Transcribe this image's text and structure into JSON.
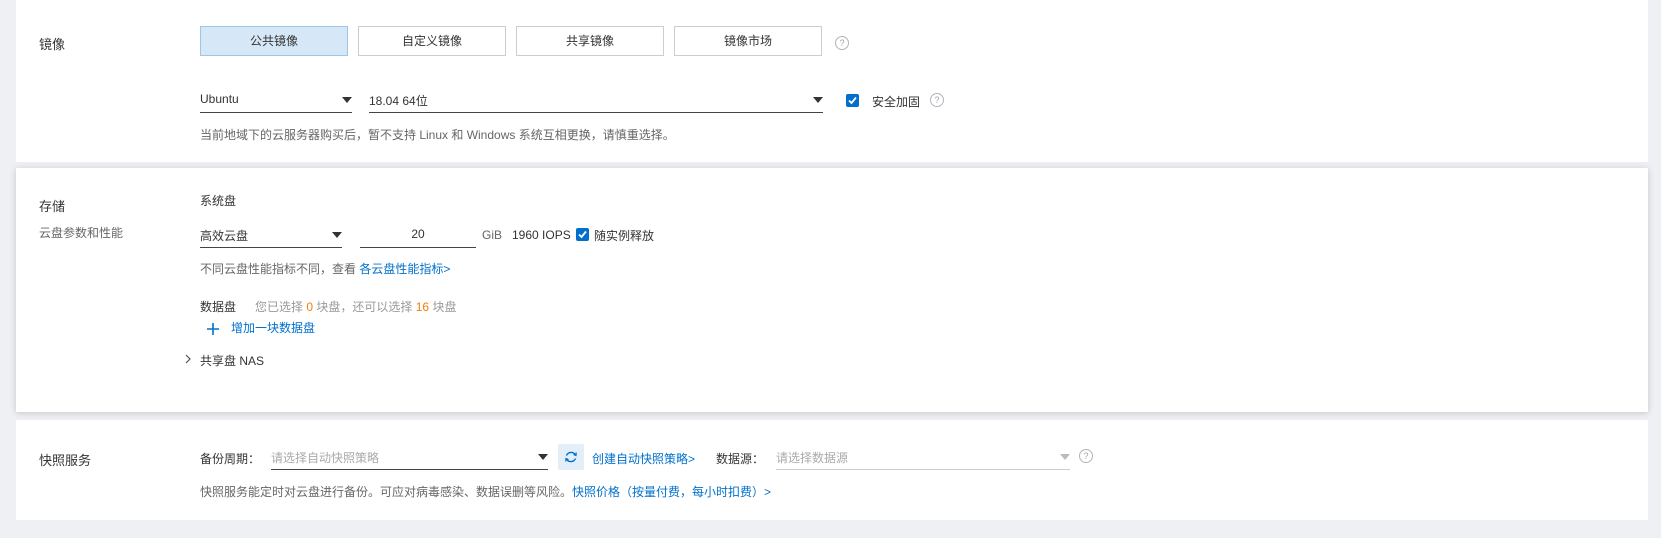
{
  "image": {
    "title": "镜像",
    "tabs": [
      {
        "label": "公共镜像",
        "active": true
      },
      {
        "label": "自定义镜像",
        "active": false
      },
      {
        "label": "共享镜像",
        "active": false
      },
      {
        "label": "镜像市场",
        "active": false
      }
    ],
    "os_value": "Ubuntu",
    "version_value": "18.04 64位",
    "security_label": "安全加固",
    "security_checked": true,
    "hint": "当前地域下的云服务器购买后，暂不支持 Linux 和 Windows 系统互相更换，请慎重选择。"
  },
  "storage": {
    "title": "存储",
    "subtitle": "云盘参数和性能",
    "system_disk_label": "系统盘",
    "disk_type": "高效云盘",
    "size": "20",
    "unit": "GiB",
    "iops": "1960 IOPS",
    "release_label": "随实例释放",
    "release_checked": true,
    "perf_hint": "不同云盘性能指标不同，查看",
    "perf_link": "各云盘性能指标>",
    "data_disk_label": "数据盘",
    "data_hint_1": "您已选择",
    "data_selected": "0",
    "data_hint_2": "块盘，还可以选择",
    "data_remaining": "16",
    "data_hint_3": "块盘",
    "add_disk_label": "增加一块数据盘",
    "nas_label": "共享盘 NAS"
  },
  "snapshot": {
    "title": "快照服务",
    "backup_label": "备份周期：",
    "backup_placeholder": "请选择自动快照策略",
    "create_policy_link": "创建自动快照策略>",
    "source_label": "数据源：",
    "source_placeholder": "请选择数据源",
    "hint": "快照服务能定时对云盘进行备份。可应对病毒感染、数据误删等风险。",
    "price_link": "快照价格（按量付费，每小时扣费）>"
  },
  "colors": {
    "accent": "#0070cc",
    "orange": "#f57c0a",
    "active_tab_bg": "#d6e8f7"
  }
}
